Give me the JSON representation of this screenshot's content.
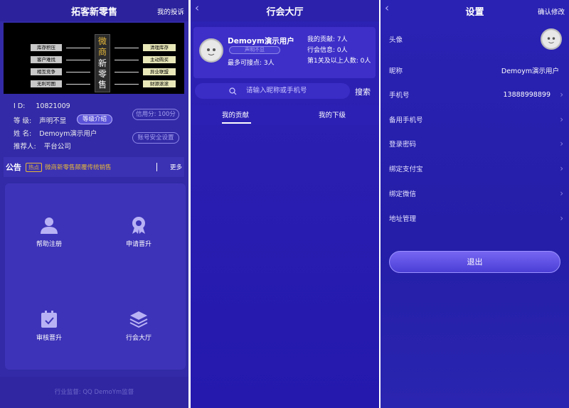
{
  "p1": {
    "title": "拓客新零售",
    "right_link": "我的投诉",
    "banner": {
      "left": [
        "库存积压",
        "客户难找",
        "相互竞争",
        "无利可图"
      ],
      "center": [
        "微",
        "商",
        "新",
        "零",
        "售"
      ],
      "right": [
        "清理库存",
        "主动购买",
        "异业联盟",
        "财源滚滚"
      ]
    },
    "info": {
      "id_label": "I    D:",
      "id_value": "10821009",
      "level_label": "等    级:",
      "level_value": "声明不显",
      "level_btn": "等级介绍",
      "name_label": "姓    名:",
      "name_value": "Demoym演示用户",
      "ref_label": "推荐人:",
      "ref_value": "平台公司",
      "credit_btn": "信用分: 100分",
      "security_btn": "账号安全设置"
    },
    "notice": {
      "label": "公告",
      "tag": "热点",
      "text": "微商新零售颠覆传统销售",
      "more": "更多"
    },
    "grid": [
      "帮助注册",
      "申请晋升",
      "审核晋升",
      "行会大厅"
    ],
    "footer": "行业监督: QQ DemoYm监督"
  },
  "p2": {
    "title": "行会大厅",
    "user_name": "Demoym演示用户",
    "user_tag": "声明不显",
    "max_label": "最多可接点:",
    "max_value": "3人",
    "contrib_label": "我的贡献:",
    "contrib_value": "7人",
    "guild_label": "行会信息:",
    "guild_value": "0人",
    "level_label": "第1关及以上人数:",
    "level_value": "0人",
    "search_placeholder": "请输入昵称或手机号",
    "search_btn": "搜索",
    "tab1": "我的贡献",
    "tab2": "我的下级"
  },
  "p3": {
    "title": "设置",
    "right_link": "确认修改",
    "rows": [
      {
        "label": "头像",
        "value": ""
      },
      {
        "label": "昵称",
        "value": "Demoym演示用户"
      },
      {
        "label": "手机号",
        "value": "13888998899"
      },
      {
        "label": "备用手机号",
        "value": ""
      },
      {
        "label": "登录密码",
        "value": ""
      },
      {
        "label": "绑定支付宝",
        "value": ""
      },
      {
        "label": "绑定微信",
        "value": ""
      },
      {
        "label": "地址管理",
        "value": ""
      }
    ],
    "logout": "退出"
  },
  "colors": {
    "primary": "#2a22b3",
    "accent": "#e6b83a"
  }
}
